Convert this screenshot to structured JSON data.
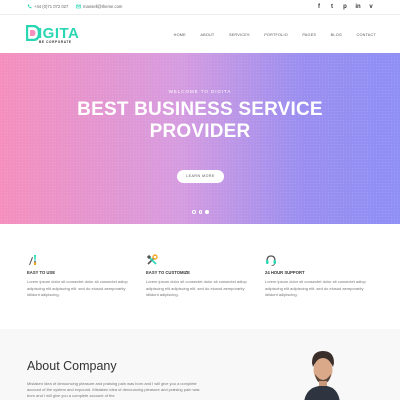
{
  "topbar": {
    "phone": "+44 (0)71 072 027",
    "email": "mansell@theme.com",
    "socials": [
      {
        "icon": "facebook-icon",
        "glyph": "f"
      },
      {
        "icon": "twitter-icon",
        "glyph": "t"
      },
      {
        "icon": "pinterest-icon",
        "glyph": "p"
      },
      {
        "icon": "linkedin-icon",
        "glyph": "in"
      },
      {
        "icon": "vimeo-icon",
        "glyph": "v"
      }
    ]
  },
  "header": {
    "logo_text": "IGITA",
    "logo_tagline": "BE CORPORATE",
    "nav": [
      "HOME",
      "ABOUT",
      "SERVICES",
      "PORTFOLIO",
      "PAGES",
      "BLOG",
      "CONTACT"
    ]
  },
  "hero": {
    "kicker": "WELCOME TO DIGITA",
    "title_line1": "BEST BUSINESS SERVICE",
    "title_line2": "PROVIDER",
    "button": "LEARN MORE",
    "slides": 3,
    "active_slide": 3
  },
  "features": [
    {
      "icon": "paint-brush-icon",
      "title": "EASY TO USE",
      "desc": "Lorem ipsum dolor sit consectet dolor sit consectet adiop adipiscing elit adipiscing elit. sed do eiusod aemporarity idiidunt adipiscing."
    },
    {
      "icon": "tools-icon",
      "title": "EASY TO CUSTOMIZE",
      "desc": "Lorem ipsum dolor sit consectet dolor sit consectet adiop adipiscing elit adipiscing elit. sed do eiusod aemporarity idiidunt adipiscing."
    },
    {
      "icon": "headset-icon",
      "title": "24 HOUR SUPPORT",
      "desc": "Lorem ipsum dolor sit consectet dolor sit consectet adiop adipiscing elit adipiscing elit. sed do eiusod aemporarity idiidunt adipiscing."
    }
  ],
  "about": {
    "title": "About Company",
    "text": "Mistaken idea of denouncing pleasure and praising pain was born and I will give you a complete account of the system and expound. Mistaken idea of denouncing pleasure and praising pain was born and I will give you a complete account of the"
  },
  "colors": {
    "accent": "#2bd6b3",
    "hero_gradient_start": "#f58fbd",
    "hero_gradient_end": "#8f8ff5"
  }
}
